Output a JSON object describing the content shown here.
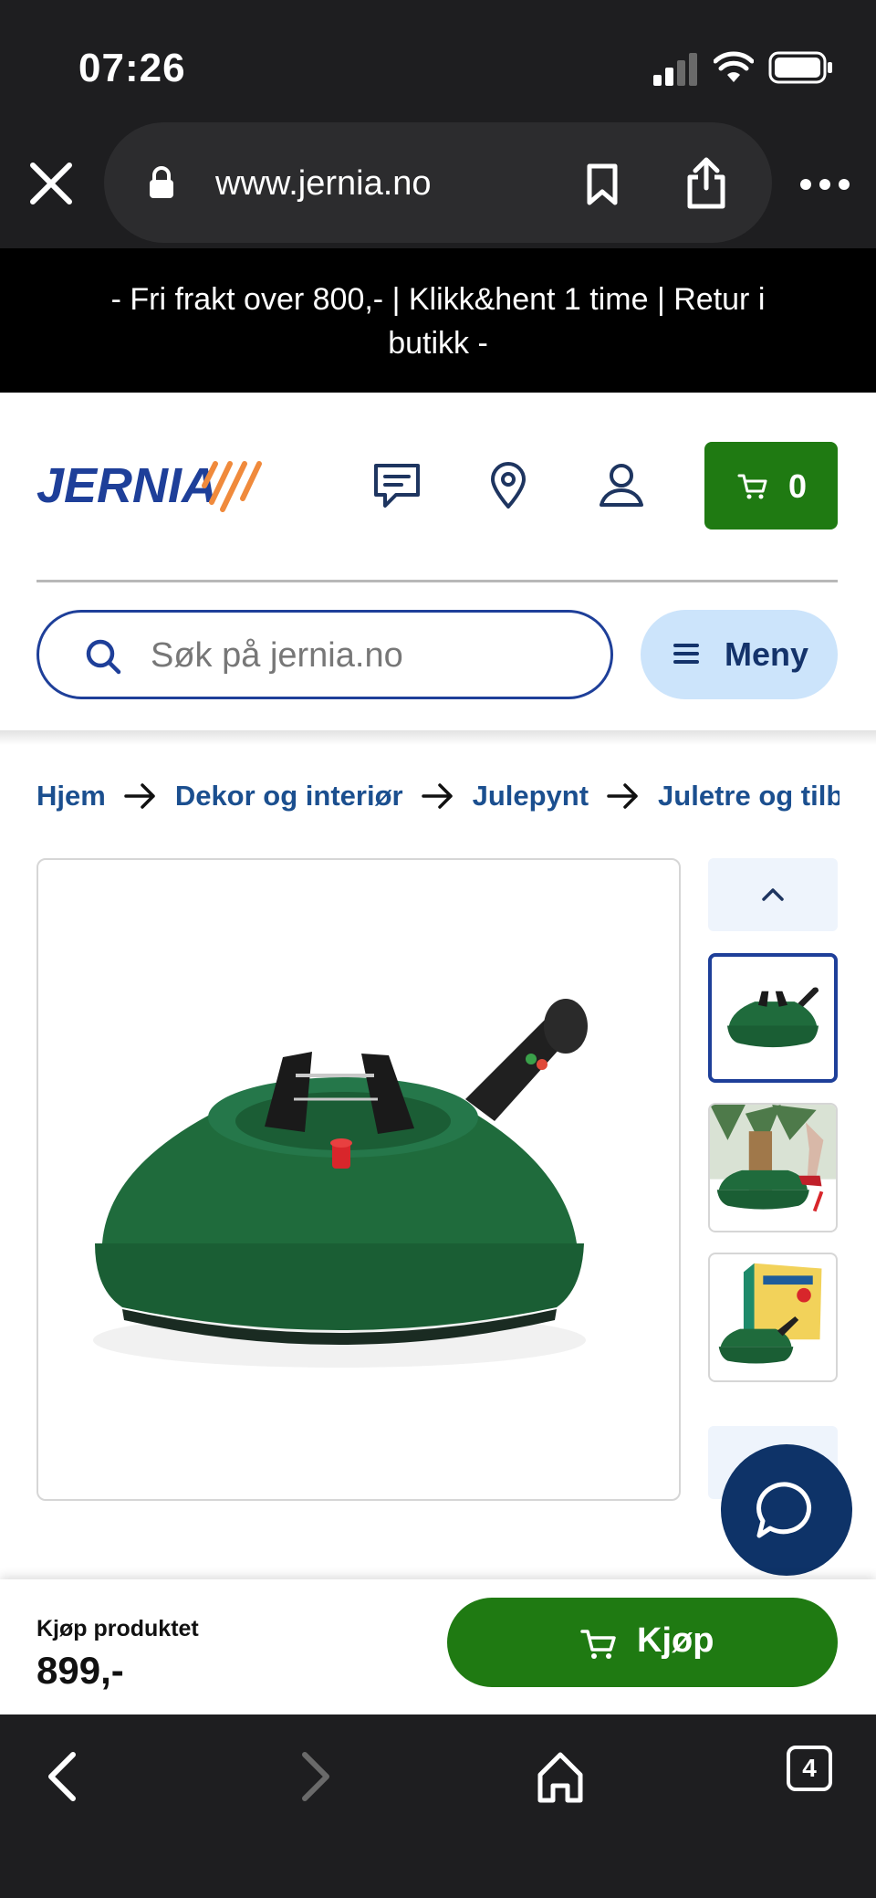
{
  "status_bar": {
    "time": "07:26"
  },
  "browser": {
    "url": "www.jernia.no",
    "tabs_count": "4"
  },
  "promo": {
    "text": "- Fri frakt over 800,- | Klikk&hent 1 time | Retur i butikk -"
  },
  "header": {
    "logo_text": "JERNIA",
    "cart_count": "0",
    "search_placeholder": "Søk på jernia.no",
    "menu_label": "Meny"
  },
  "breadcrumb": [
    {
      "label": "Hjem"
    },
    {
      "label": "Dekor og interiør"
    },
    {
      "label": "Julepynt"
    },
    {
      "label": "Juletre og tilbehør"
    }
  ],
  "buy_bar": {
    "label": "Kjøp produktet",
    "price": "899,-",
    "button_label": "Kjøp"
  },
  "colors": {
    "brand_blue": "#1e3f99",
    "brand_orange": "#f08a3c",
    "buy_green": "#1f7a12",
    "stand_green": "#1f6b3c",
    "link_blue": "#1b4f8f",
    "chat_navy": "#0e3368"
  },
  "icons": {
    "header": [
      "chat-bubble-icon",
      "location-pin-icon",
      "user-icon",
      "cart-icon"
    ],
    "toolbar": [
      "back-icon",
      "forward-icon",
      "home-icon",
      "tabs-icon"
    ]
  }
}
